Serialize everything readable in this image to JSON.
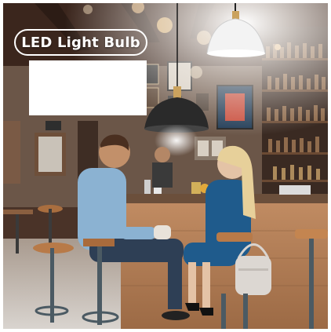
{
  "badge": {
    "label": "LED Light Bulb",
    "color": "#ffffff"
  },
  "blank_box": {
    "color": "#ffffff"
  },
  "scene": {
    "description_icons": [
      "pendant-lamp-icon",
      "bar-shelf",
      "stool",
      "person"
    ],
    "accent_light": "#fff7dc",
    "wood_tone": "#b9835a"
  }
}
